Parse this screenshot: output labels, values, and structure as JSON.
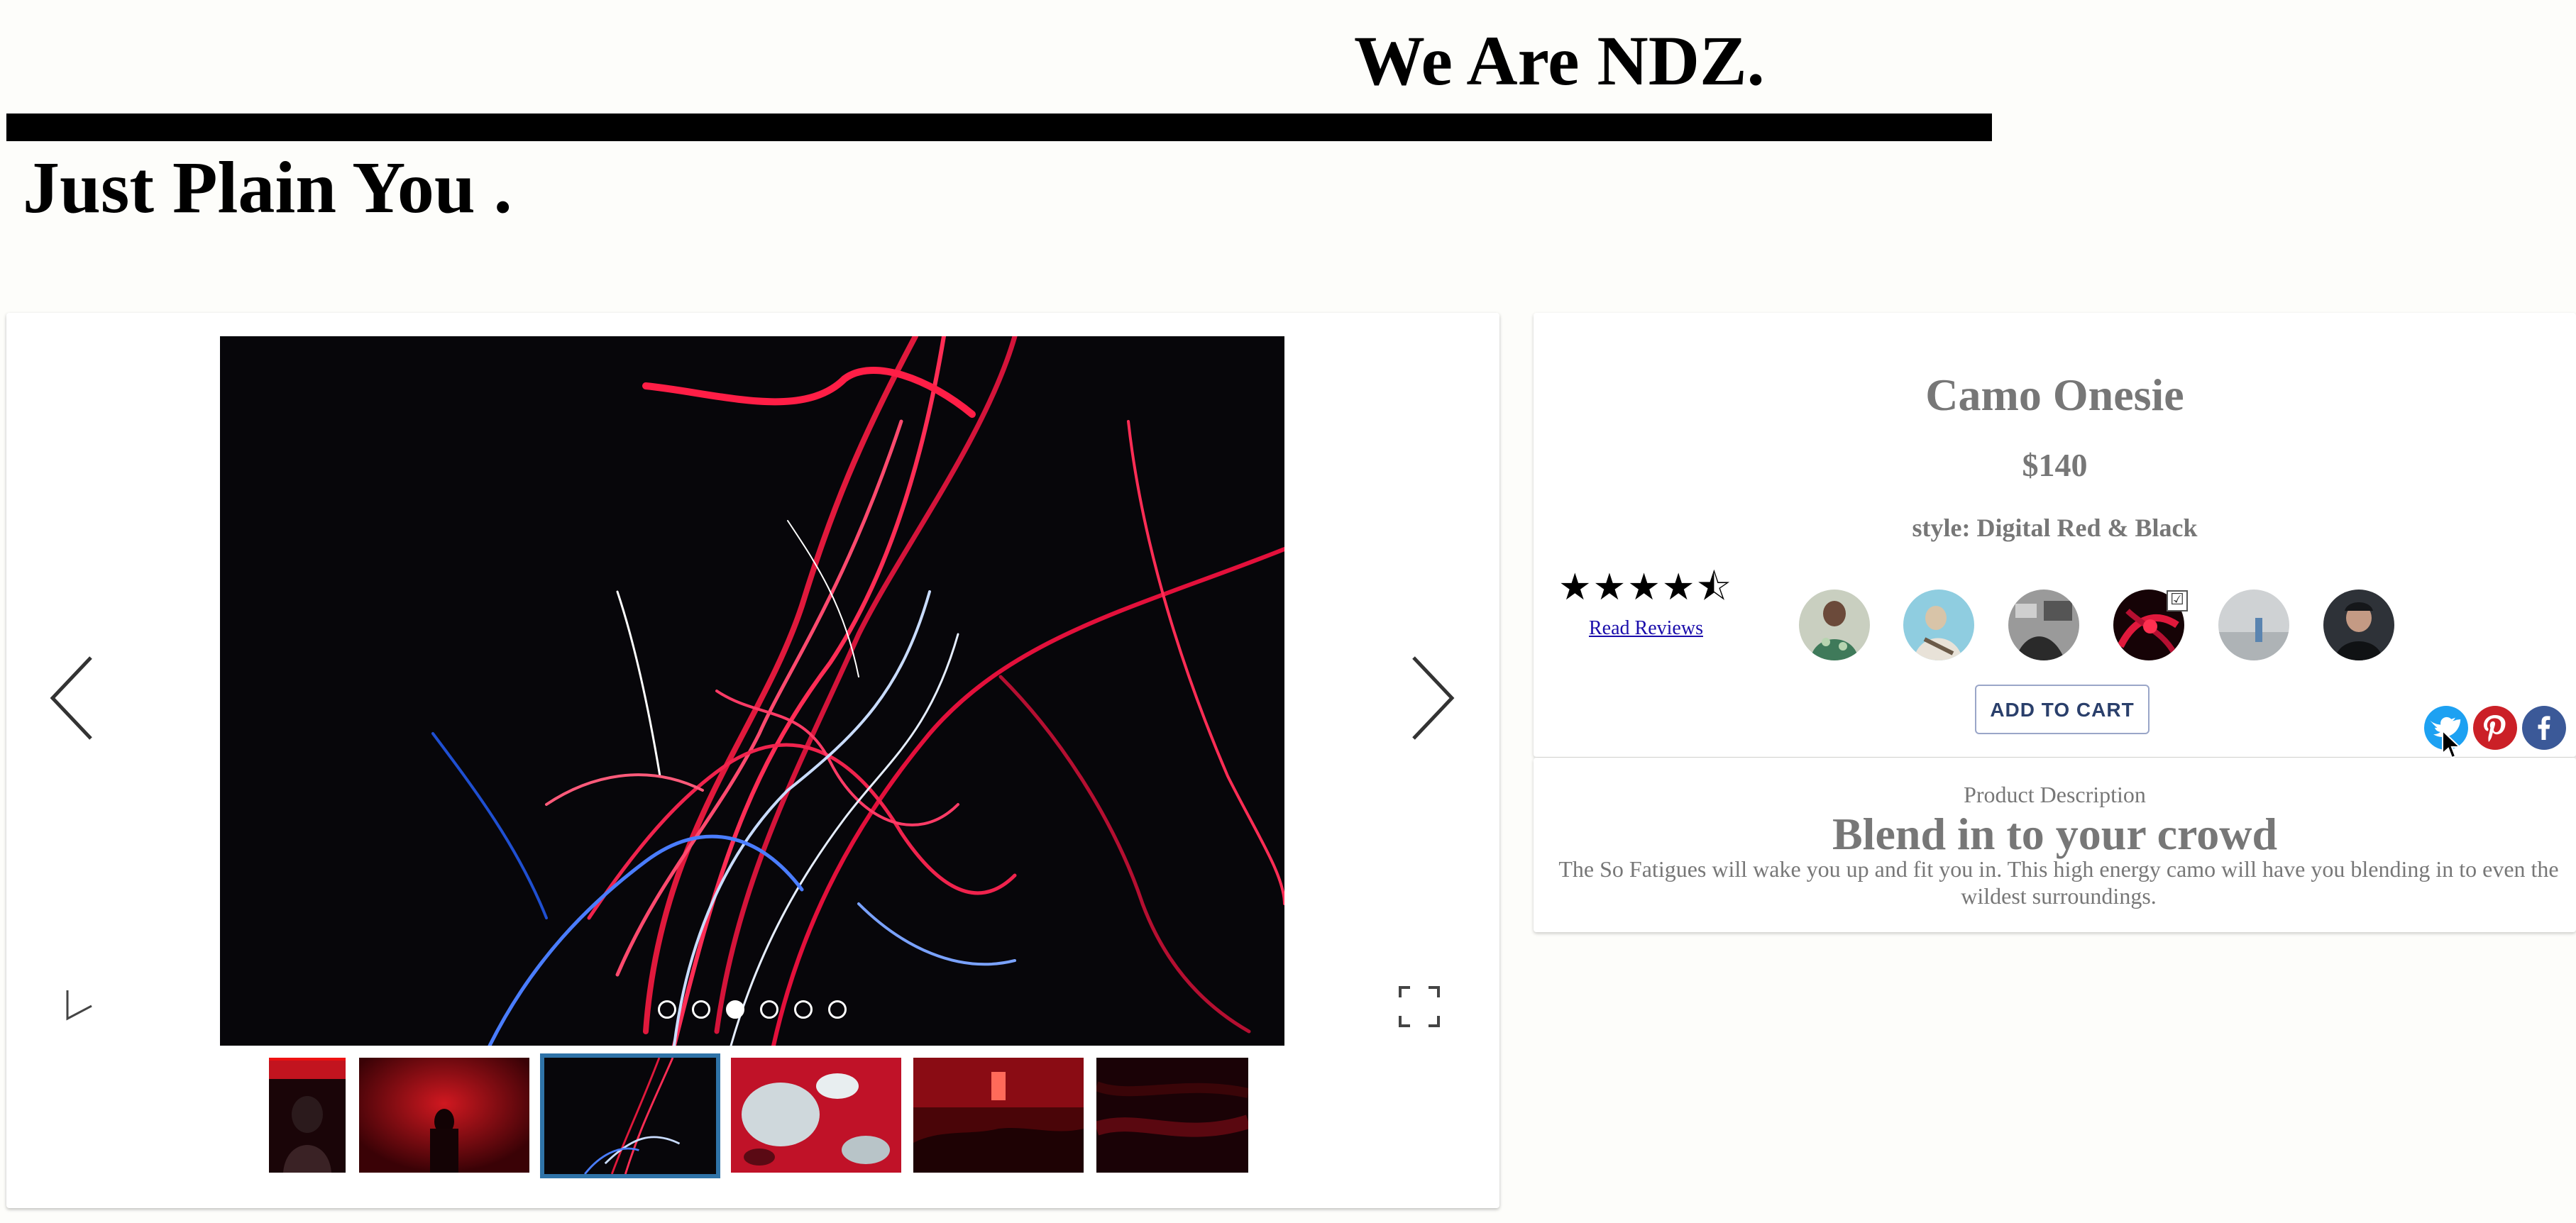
{
  "header": {
    "brand": "We Are NDZ.",
    "tagline": "Just Plain You ."
  },
  "gallery": {
    "prev_icon": "chevron-left-icon",
    "next_icon": "chevron-right-icon",
    "play_icon": "play-icon",
    "fullscreen_icon": "fullscreen-icon",
    "slide_count": 6,
    "active_slide": 3,
    "thumbnails": [
      {
        "name": "thumb-portrait-red"
      },
      {
        "name": "thumb-smoke-figure"
      },
      {
        "name": "thumb-light-trails",
        "active": true
      },
      {
        "name": "thumb-red-ice"
      },
      {
        "name": "thumb-red-concert"
      },
      {
        "name": "thumb-dark-red"
      }
    ],
    "active_thumb_border": "#2f73a8"
  },
  "product": {
    "title": "Camo Onesie",
    "price": "$140",
    "style": "style: Digital Red & Black",
    "rating": 4.5,
    "rating_max": 5,
    "stars_text": "★★★★⯪",
    "reviews_link": "Read Reviews",
    "add_to_cart": "ADD TO CART",
    "swatches": [
      {
        "name": "swatch-green-patterned"
      },
      {
        "name": "swatch-light-blue"
      },
      {
        "name": "swatch-grey-room"
      },
      {
        "name": "swatch-red-black",
        "selected": true
      },
      {
        "name": "swatch-light-grey"
      },
      {
        "name": "swatch-dark-portrait"
      }
    ],
    "selected_check": "☑"
  },
  "social": [
    {
      "name": "twitter-icon",
      "color": "#1da1f2"
    },
    {
      "name": "pinterest-icon",
      "color": "#cb2027"
    },
    {
      "name": "facebook-icon",
      "color": "#3b5998"
    }
  ],
  "description": {
    "label": "Product Description",
    "heading": "Blend in to your crowd",
    "text": "The So Fatigues will wake you up and fit you in. This high energy camo will have you blending in to even the wildest surroundings."
  }
}
